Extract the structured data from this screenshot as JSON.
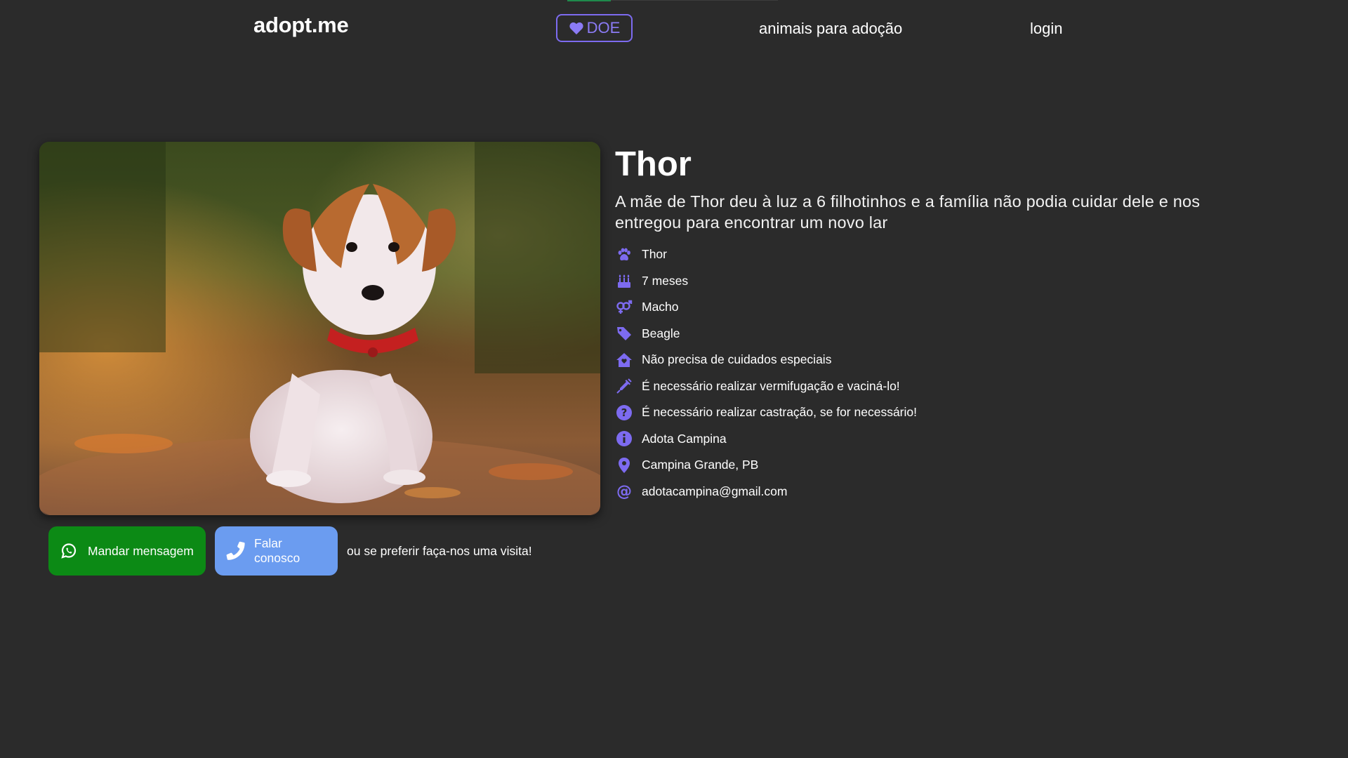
{
  "header": {
    "logo": "adopt.me",
    "donate_label": "DOE",
    "nav": [
      {
        "label": "animais para adoção"
      },
      {
        "label": "login"
      }
    ]
  },
  "pet": {
    "name": "Thor",
    "description": "A mãe de Thor deu à luz a 6 filhotinhos e a família não podia cuidar dele e nos entregou para encontrar um novo lar",
    "attributes": [
      {
        "icon": "paw-icon",
        "value": "Thor"
      },
      {
        "icon": "birthday-cake-icon",
        "value": "7 meses"
      },
      {
        "icon": "gender-icon",
        "value": "Macho"
      },
      {
        "icon": "tag-icon",
        "value": "Beagle"
      },
      {
        "icon": "house-icon",
        "value": "Não precisa de cuidados especiais"
      },
      {
        "icon": "syringe-icon",
        "value": "É necessário realizar vermifugação e vaciná-lo!"
      },
      {
        "icon": "question-circle-icon",
        "value": "É necessário realizar castração, se for necessário!"
      },
      {
        "icon": "info-circle-icon",
        "value": "Adota Campina"
      },
      {
        "icon": "location-pin-icon",
        "value": "Campina Grande, PB"
      },
      {
        "icon": "at-icon",
        "value": "adotacampina@gmail.com"
      }
    ]
  },
  "actions": {
    "whatsapp_label": "Mandar mensagem",
    "call_label": "Falar conosco",
    "visit_text": "ou se preferir faça-nos uma visita!"
  },
  "colors": {
    "background": "#2b2b2b",
    "accent_purple": "#7d6bf0",
    "whatsapp_green": "#0c8a15",
    "call_blue": "#6b9cf0"
  }
}
